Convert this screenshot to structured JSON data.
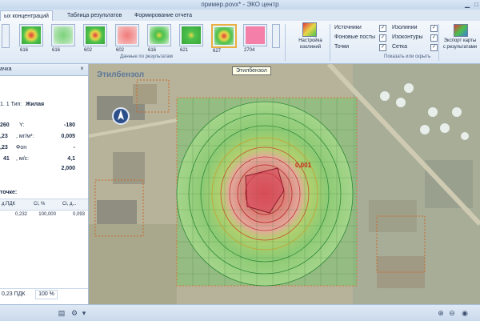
{
  "window": {
    "title": "пример.povx* - ЭКО центр"
  },
  "tabs": [
    {
      "label": "ых концентраций"
    },
    {
      "label": "Таблица результатов"
    },
    {
      "label": "Формирование отчета"
    }
  ],
  "ribbon": {
    "thumbnails": [
      {
        "caption": "616"
      },
      {
        "caption": "616"
      },
      {
        "caption": "602"
      },
      {
        "caption": "602"
      },
      {
        "caption": "616"
      },
      {
        "caption": "621"
      },
      {
        "caption": "627"
      },
      {
        "caption": "2704"
      }
    ],
    "group_results_label": "Данные по результатам",
    "isolines_settings_label_1": "Настройка",
    "isolines_settings_label_2": "изолиний",
    "checkboxes": [
      {
        "label": "Источники",
        "checked": "✓"
      },
      {
        "label": "Фоновые посты",
        "checked": "✓"
      },
      {
        "label": "Точки",
        "checked": "✓"
      },
      {
        "label": "Изолинии",
        "checked": "✓"
      },
      {
        "label": "Изоконтуры",
        "checked": "✓"
      },
      {
        "label": "Сетка",
        "checked": "✓"
      }
    ],
    "show_hide_label": "Показать или скрыть",
    "export_label_1": "Экспорт карты",
    "export_label_2": "с результатами"
  },
  "left_panel": {
    "header": "ачка",
    "line1_prefix": "1. 1 Тип:",
    "line1_type": "Жилая",
    "line2_left": "260",
    "line2_mid": "Y:",
    "line2_right": "-180",
    "line3_left": ",23",
    "line3_mid": ", мг/м³:",
    "line3_right": "0,005",
    "line4_left": ",23",
    "line4_mid": "Фон",
    "line4_right": "-",
    "line5_left": "41",
    "line5_mid": ", м/с:",
    "line5_right": "4,1",
    "line6_right": "2,000",
    "section_title": "точке:",
    "table_headers": [
      "д.ПДК",
      "Ci, %",
      "Ci, д..."
    ],
    "table_values": [
      "0,232",
      "100,000",
      "0,093"
    ],
    "footer_left": "0,23 ПДК",
    "footer_right": "100 %"
  },
  "map": {
    "title": "Этилбензол",
    "tooltip": "Этилбензол",
    "contour_label": "0,001"
  },
  "colors": {
    "accent": "#e8b040",
    "ribbon_bg": "#dfe9f5",
    "map_title": "#5d7896"
  }
}
